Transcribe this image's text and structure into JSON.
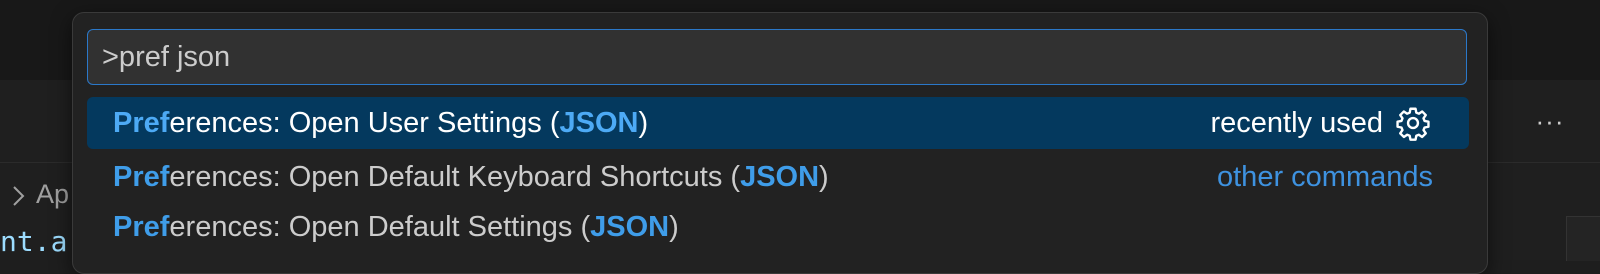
{
  "quick_input": {
    "value": ">pref json"
  },
  "items": [
    {
      "match": "Pref",
      "rest_before": "erences: Open User Settings (",
      "match2": "JSON",
      "rest_after": ")",
      "right_label": "recently used",
      "right_icon": "gear-icon",
      "selected": true
    },
    {
      "match": "Pref",
      "rest_before": "erences: Open Default Keyboard Shortcuts (",
      "match2": "JSON",
      "rest_after": ")",
      "right_label": "other commands",
      "selected": false
    },
    {
      "match": "Pref",
      "rest_before": "erences: Open Default Settings (",
      "match2": "JSON",
      "rest_after": ")",
      "selected": false
    }
  ],
  "background": {
    "more_actions": "···",
    "breadcrumb": "Ap",
    "code_fragment": "nt.a"
  },
  "colors": {
    "accent": "#3f9de9",
    "selected_bg": "#04395e",
    "input_border": "#2b78c9"
  }
}
